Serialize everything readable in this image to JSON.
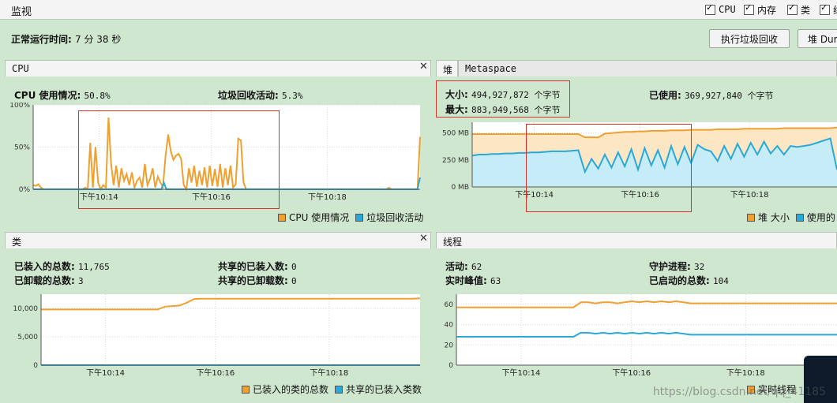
{
  "top": {
    "title": "监视",
    "checks": [
      "CPU",
      "内存",
      "类",
      "线"
    ],
    "uptime_label": "正常运行时间:",
    "uptime_value": "7 分 38 秒",
    "gc_button": "执行垃圾回收",
    "dump_button": "堆 Dum"
  },
  "cpu": {
    "tab": "CPU",
    "usage_label": "CPU 使用情况:",
    "usage_value": "50.8%",
    "gc_label": "垃圾回收活动:",
    "gc_value": "5.3%",
    "legend": [
      "CPU 使用情况",
      "垃圾回收活动"
    ]
  },
  "heap": {
    "tabs": [
      "堆",
      "Metaspace"
    ],
    "size_label": "大小:",
    "size_value": "494,927,872 个字节",
    "max_label": "最大:",
    "max_value": "883,949,568 个字节",
    "used_label": "已使用:",
    "used_value": "369,927,840 个字节",
    "legend": [
      "堆 大小",
      "使用的"
    ]
  },
  "classes": {
    "tab": "类",
    "loaded_label": "已装入的总数:",
    "loaded_value": "11,765",
    "unloaded_label": "已卸载的总数:",
    "unloaded_value": "3",
    "shared_loaded_label": "共享的已装入数:",
    "shared_loaded_value": "0",
    "shared_unloaded_label": "共享的已卸载数:",
    "shared_unloaded_value": "0",
    "legend": [
      "已装入的类的总数",
      "共享的已装入类数"
    ]
  },
  "threads": {
    "tab": "线程",
    "live_label": "活动:",
    "live_value": "62",
    "peak_label": "实时峰值:",
    "peak_value": "63",
    "daemon_label": "守护进程:",
    "daemon_value": "32",
    "started_label": "已启动的总数:",
    "started_value": "104",
    "legend": [
      "实时线程"
    ]
  },
  "watermark": "https://blog.csdn.net/qq_41185",
  "colors": {
    "orange": "#f0a030",
    "blue": "#2aa8d8",
    "bg": "#cfe6cf",
    "red": "#d9322a"
  },
  "chart_data": [
    {
      "type": "line",
      "title": "CPU",
      "x_ticks": [
        "下午10:14",
        "下午10:16",
        "下午10:18"
      ],
      "y_ticks": [
        "0%",
        "50%",
        "100%"
      ],
      "ylim": [
        0,
        100
      ],
      "series": [
        {
          "name": "CPU 使用情况",
          "color": "#f0a030",
          "values": [
            5,
            4,
            6,
            2,
            0,
            0,
            0,
            0,
            0,
            0,
            0,
            0,
            0,
            0,
            0,
            0,
            0,
            0,
            0,
            0,
            2,
            0,
            55,
            2,
            50,
            8,
            0,
            5,
            2,
            85,
            30,
            5,
            28,
            2,
            25,
            10,
            18,
            5,
            20,
            2,
            10,
            14,
            2,
            30,
            5,
            12,
            25,
            2,
            15,
            8,
            3,
            40,
            65,
            45,
            35,
            40,
            42,
            36,
            5,
            0,
            25,
            8,
            28,
            3,
            22,
            5,
            26,
            2,
            28,
            4,
            24,
            3,
            30,
            2,
            25,
            5,
            28,
            2,
            6,
            60,
            58,
            8,
            0,
            0,
            0,
            0,
            0,
            0,
            0,
            0,
            0,
            0,
            0,
            0,
            0,
            0,
            0,
            0,
            0,
            0,
            0,
            0,
            0,
            0,
            0,
            0,
            0,
            0,
            0,
            0,
            0,
            0,
            0,
            0,
            0,
            0,
            0,
            0,
            0,
            0,
            0,
            0,
            0,
            0,
            0,
            0,
            0,
            0,
            0,
            0,
            0,
            0,
            0,
            0,
            0,
            0,
            0,
            2,
            0,
            0,
            0,
            0,
            0,
            0,
            0,
            0,
            0,
            0,
            0,
            62
          ]
        },
        {
          "name": "垃圾回收活动",
          "color": "#2aa8d8",
          "values": [
            0,
            0,
            0,
            0,
            0,
            0,
            0,
            0,
            0,
            0,
            0,
            0,
            0,
            0,
            0,
            0,
            0,
            0,
            0,
            0,
            0,
            0,
            0,
            0,
            0,
            0,
            0,
            0,
            0,
            0,
            0,
            0,
            0,
            0,
            0,
            0,
            0,
            0,
            0,
            0,
            0,
            0,
            0,
            0,
            0,
            0,
            0,
            0,
            0,
            0,
            0,
            0,
            8,
            0,
            0,
            0,
            0,
            0,
            0,
            0,
            0,
            0,
            0,
            0,
            0,
            0,
            0,
            0,
            0,
            0,
            0,
            0,
            0,
            0,
            0,
            0,
            0,
            0,
            0,
            0,
            0,
            0,
            0,
            0,
            0,
            0,
            0,
            0,
            0,
            0,
            0,
            0,
            0,
            0,
            0,
            0,
            0,
            0,
            0,
            0,
            0,
            0,
            0,
            0,
            0,
            0,
            0,
            0,
            0,
            0,
            0,
            0,
            0,
            0,
            0,
            0,
            0,
            0,
            0,
            0,
            0,
            0,
            0,
            0,
            0,
            0,
            0,
            0,
            0,
            0,
            0,
            0,
            0,
            0,
            0,
            0,
            0,
            0,
            0,
            0,
            0,
            0,
            0,
            0,
            0,
            0,
            0,
            0,
            0,
            0,
            0,
            0,
            0,
            0,
            14
          ]
        }
      ]
    },
    {
      "type": "area",
      "title": "堆",
      "x_ticks": [
        "下午10:14",
        "下午10:16",
        "下午10:18"
      ],
      "y_ticks": [
        "0 MB",
        "250 MB",
        "500 MB"
      ],
      "ylim": [
        0,
        600
      ],
      "series": [
        {
          "name": "堆 大小",
          "color": "#f0a030",
          "values": [
            490,
            490,
            490,
            490,
            490,
            490,
            490,
            490,
            490,
            490,
            490,
            490,
            490,
            490,
            490,
            490,
            490,
            460,
            460,
            460,
            495,
            500,
            505,
            510,
            510,
            515,
            515,
            520,
            520,
            520,
            525,
            525,
            525,
            530,
            530,
            530,
            530,
            535,
            535,
            535,
            535,
            540,
            540,
            540,
            540,
            540,
            540,
            545,
            545,
            545,
            545,
            545,
            545,
            545,
            545,
            550
          ]
        },
        {
          "name": "使用的",
          "color": "#2aa8d8",
          "values": [
            290,
            300,
            300,
            305,
            305,
            310,
            310,
            315,
            315,
            320,
            320,
            325,
            330,
            330,
            330,
            335,
            340,
            140,
            260,
            170,
            300,
            180,
            320,
            190,
            350,
            160,
            360,
            200,
            340,
            180,
            380,
            210,
            370,
            220,
            390,
            350,
            330,
            240,
            380,
            260,
            400,
            280,
            410,
            300,
            420,
            310,
            380,
            300,
            380,
            370,
            380,
            390,
            410,
            430,
            450,
            160
          ]
        }
      ]
    },
    {
      "type": "line",
      "title": "类",
      "x_ticks": [
        "下午10:14",
        "下午10:16",
        "下午10:18"
      ],
      "y_ticks": [
        "0",
        "5,000",
        "10,000"
      ],
      "ylim": [
        0,
        12500
      ],
      "series": [
        {
          "name": "已装入的类的总数",
          "color": "#f0a030",
          "values": [
            9800,
            9800,
            9800,
            9800,
            9800,
            9800,
            9800,
            9800,
            9800,
            9800,
            9800,
            9800,
            9800,
            9800,
            9800,
            9800,
            9800,
            10300,
            10400,
            10500,
            11000,
            11650,
            11700,
            11700,
            11700,
            11700,
            11700,
            11700,
            11700,
            11700,
            11700,
            11700,
            11700,
            11700,
            11700,
            11700,
            11700,
            11700,
            11700,
            11700,
            11700,
            11700,
            11700,
            11700,
            11700,
            11700,
            11700,
            11700,
            11700,
            11700,
            11700,
            11700,
            11765
          ]
        },
        {
          "name": "共享的已装入类数",
          "color": "#2aa8d8",
          "values": [
            0,
            0,
            0,
            0,
            0,
            0,
            0,
            0,
            0,
            0,
            0,
            0,
            0,
            0,
            0,
            0,
            0,
            0,
            0,
            0,
            0,
            0,
            0,
            0,
            0,
            0,
            0,
            0,
            0,
            0,
            0,
            0,
            0,
            0,
            0,
            0,
            0,
            0,
            0,
            0,
            0,
            0,
            0,
            0,
            0,
            0,
            0,
            0,
            0,
            0,
            0,
            0,
            0
          ]
        }
      ]
    },
    {
      "type": "line",
      "title": "线程",
      "x_ticks": [
        "下午10:14",
        "下午10:16",
        "下午10:18"
      ],
      "y_ticks": [
        "0",
        "20",
        "40",
        "60"
      ],
      "ylim": [
        0,
        70
      ],
      "series": [
        {
          "name": "实时线程",
          "color": "#f0a030",
          "values": [
            57,
            57,
            57,
            57,
            57,
            57,
            57,
            57,
            57,
            57,
            57,
            57,
            57,
            57,
            57,
            57,
            57,
            62,
            62,
            61,
            62,
            62,
            61,
            62,
            63,
            62,
            63,
            62,
            63,
            62,
            63,
            62,
            61,
            61,
            61,
            61,
            61,
            61,
            61,
            61,
            61,
            61,
            61,
            61,
            61,
            61,
            61,
            61,
            61,
            61,
            61,
            61,
            61
          ]
        },
        {
          "name": "守护进程",
          "color": "#2aa8d8",
          "values": [
            28,
            28,
            28,
            28,
            28,
            28,
            28,
            28,
            28,
            28,
            28,
            28,
            28,
            28,
            28,
            28,
            28,
            32,
            32,
            31,
            32,
            31,
            32,
            31,
            32,
            31,
            32,
            31,
            32,
            31,
            32,
            31,
            30,
            30,
            30,
            30,
            30,
            30,
            30,
            30,
            30,
            30,
            30,
            30,
            30,
            30,
            30,
            30,
            30,
            30,
            30,
            30,
            30
          ]
        }
      ]
    }
  ]
}
